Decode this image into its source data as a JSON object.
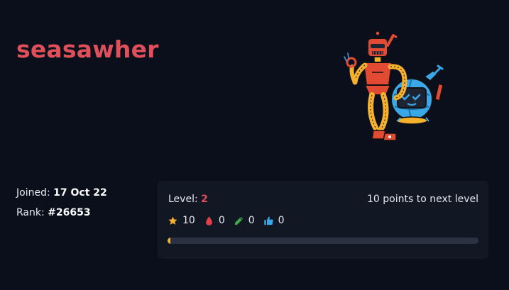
{
  "profile": {
    "username": "seasawher",
    "joined_label": "Joined:",
    "joined_value": "17 Oct 22",
    "rank_label": "Rank:",
    "rank_value": "#26653"
  },
  "level_card": {
    "level_label": "Level:",
    "level_value": "2",
    "next_level_text": "10 points to next level",
    "progress_fraction": 0.01,
    "stats": [
      {
        "icon": "star-icon",
        "value": "10",
        "color": "#f5b12e"
      },
      {
        "icon": "blood-drop-icon",
        "value": "0",
        "color": "#e0404a"
      },
      {
        "icon": "pencil-icon",
        "value": "0",
        "color": "#3fae49"
      },
      {
        "icon": "thumbs-up-icon",
        "value": "0",
        "color": "#3aa7e8"
      }
    ]
  },
  "colors": {
    "background": "#0b0f1b",
    "card": "#121724",
    "accent": "#e0505a",
    "progress_fill": "#f5b12e",
    "progress_track": "#2b3140"
  }
}
